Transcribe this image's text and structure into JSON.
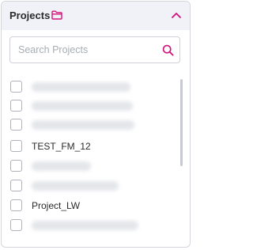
{
  "panel": {
    "title": "Projects",
    "accent_color": "#d4117a",
    "title_icon": "folder-icon",
    "collapse_icon": "chevron-up-icon"
  },
  "search": {
    "placeholder": "Search Projects",
    "value": "",
    "icon": "search-icon"
  },
  "projects": [
    {
      "label": "",
      "redacted": true,
      "checked": false
    },
    {
      "label": "",
      "redacted": true,
      "checked": false
    },
    {
      "label": "",
      "redacted": true,
      "checked": false
    },
    {
      "label": "TEST_FM_12",
      "redacted": false,
      "checked": false
    },
    {
      "label": "",
      "redacted": true,
      "checked": false
    },
    {
      "label": "",
      "redacted": true,
      "checked": false
    },
    {
      "label": "Project_LW",
      "redacted": false,
      "checked": false
    },
    {
      "label": "",
      "redacted": true,
      "checked": false
    }
  ]
}
